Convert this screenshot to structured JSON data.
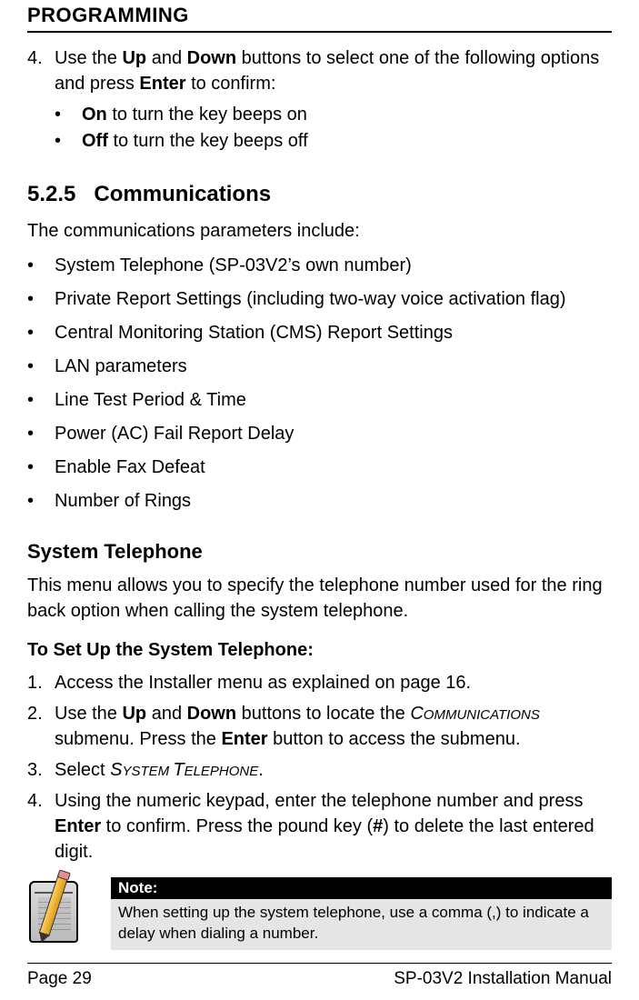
{
  "header": "PROGRAMMING",
  "step4": {
    "num": "4.",
    "pre": "Use the ",
    "up": "Up",
    "mid1": " and ",
    "down": "Down",
    "mid2": " buttons to select one of the following options and press ",
    "enter": "Enter",
    "post": " to confirm:"
  },
  "onoff": {
    "on": "On",
    "on_rest": " to turn the key beeps on",
    "off": "Off",
    "off_rest": " to turn the key beeps off"
  },
  "section": {
    "number": "5.2.5",
    "title": "Communications"
  },
  "comm_intro": "The communications parameters include:",
  "comm_bullets": [
    "System Telephone (SP-03V2’s own number)",
    "Private Report Settings (including two-way voice activation flag)",
    "Central Monitoring Station (CMS) Report Settings",
    "LAN parameters",
    "Line Test Period & Time",
    "Power (AC) Fail Report Delay",
    "Enable Fax Defeat",
    "Number of Rings"
  ],
  "systel": {
    "heading": "System Telephone",
    "para": "This menu allows you to specify the telephone number used for the ring back option when calling the system telephone."
  },
  "setup_heading": "To Set Up the System Telephone:",
  "setup": [
    {
      "num": "1.",
      "text": "Access the Installer menu as explained on page 16."
    },
    {
      "num": "2.",
      "parts": {
        "pre": "Use the ",
        "up": "Up",
        "mid1": " and ",
        "down": "Down",
        "mid2": " buttons to locate the ",
        "sc1a": "C",
        "sc1b": "OMMUNICATIONS",
        "post1": " submenu. Press the ",
        "enter": "Enter",
        "post2": " button to access the submenu."
      }
    },
    {
      "num": "3.",
      "parts": {
        "pre": "Select ",
        "sc2a": "S",
        "sc2b": "YSTEM ",
        "sc2c": "T",
        "sc2d": "ELEPHONE",
        "post": "."
      }
    },
    {
      "num": "4.",
      "parts": {
        "pre": "Using the numeric keypad, enter the telephone number and press ",
        "enter": "Enter",
        "mid": " to confirm. Press the pound key (",
        "hash": "#",
        "post": ") to delete the last entered digit."
      }
    }
  ],
  "note": {
    "label": "Note:",
    "body": "When setting up the system telephone, use a comma (,) to indicate a delay when dialing a number."
  },
  "footer": {
    "left": "Page 29",
    "right": "SP-03V2 Installation Manual"
  }
}
